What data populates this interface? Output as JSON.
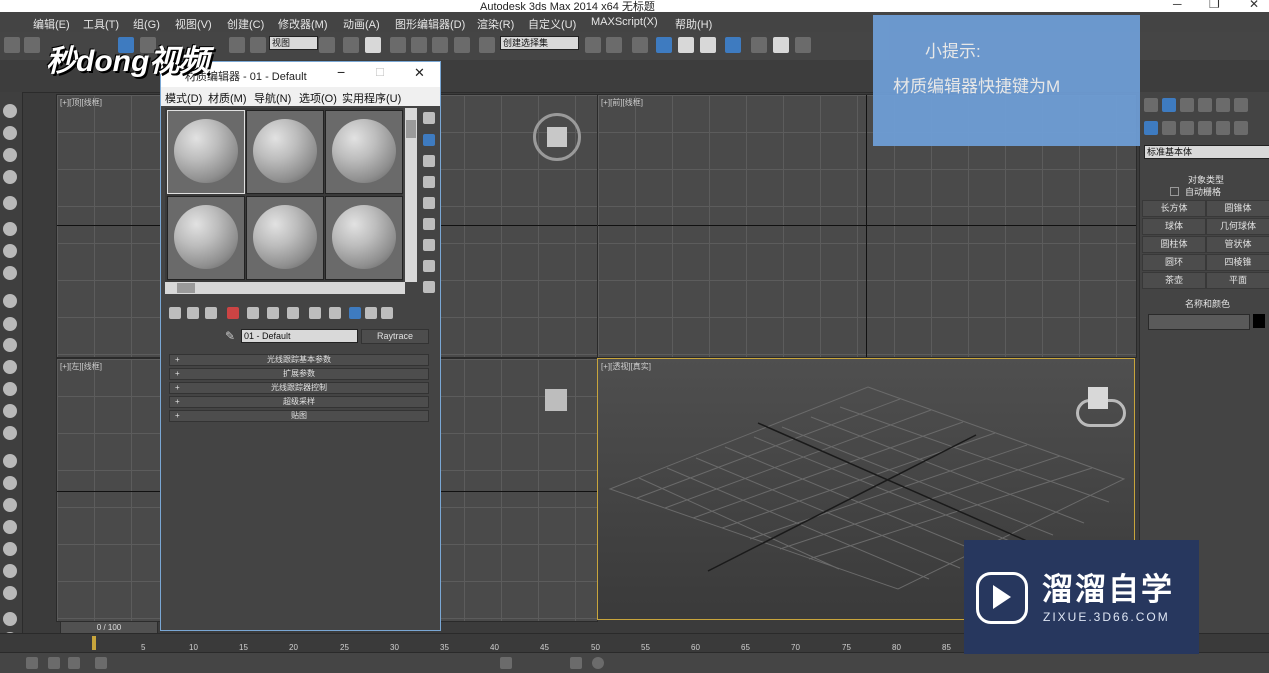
{
  "window": {
    "title": "Autodesk 3ds Max  2014 x64      无标题",
    "minimize_glyph": "─",
    "restore_glyph": "❐",
    "close_glyph": "✕"
  },
  "menubar": {
    "items": [
      "编辑(E)",
      "工具(T)",
      "组(G)",
      "视图(V)",
      "创建(C)",
      "修改器(M)",
      "动画(A)",
      "图形编辑器(D)",
      "渲染(R)",
      "自定义(U)",
      "MAXScript(X)",
      "帮助(H)"
    ]
  },
  "toolbar": {
    "view_dropdown": "视图",
    "selection_set_dropdown": "创建选择集"
  },
  "viewports": {
    "top": "[+][顶][线框]",
    "front": "[+][前][线框]",
    "left": "[+][左][线框]",
    "perspective": "[+][透视][真实]"
  },
  "material_editor": {
    "title": "材质编辑器 - 01 - Default",
    "menu": [
      "模式(D)",
      "材质(M)",
      "导航(N)",
      "选项(O)",
      "实用程序(U)"
    ],
    "material_name": "01 - Default",
    "material_type": "Raytrace",
    "rollouts": [
      "光线跟踪基本参数",
      "扩展参数",
      "光线跟踪器控制",
      "超级采样",
      "贴图"
    ],
    "slot_count": 6
  },
  "command_panel": {
    "category_dropdown": "标准基本体",
    "object_type_title": "对象类型",
    "auto_grid": "自动栅格",
    "buttons": [
      "长方体",
      "圆锥体",
      "球体",
      "几何球体",
      "圆柱体",
      "管状体",
      "圆环",
      "四棱锥",
      "茶壶",
      "平面"
    ],
    "name_color_title": "名称和颜色",
    "name_value": ""
  },
  "timeline": {
    "frame_readout": "0 / 100",
    "ticks": [
      "5",
      "10",
      "15",
      "20",
      "25",
      "30",
      "35",
      "40",
      "45",
      "50",
      "55",
      "60",
      "65",
      "70",
      "75",
      "80",
      "85"
    ]
  },
  "overlays": {
    "tip_title": "小提示:",
    "tip_text": "材质编辑器快捷键为M",
    "watermark": "秒dong视频",
    "brand_name": "溜溜自学",
    "brand_url": "ZIXUE.3D66.COM"
  },
  "colors": {
    "ui_background": "#3b3b3b",
    "viewport": "#4a4a4a",
    "active_viewport_border": "#c8a53c",
    "tip_background": "#6f9fd8",
    "brand_background": "#27375e"
  }
}
